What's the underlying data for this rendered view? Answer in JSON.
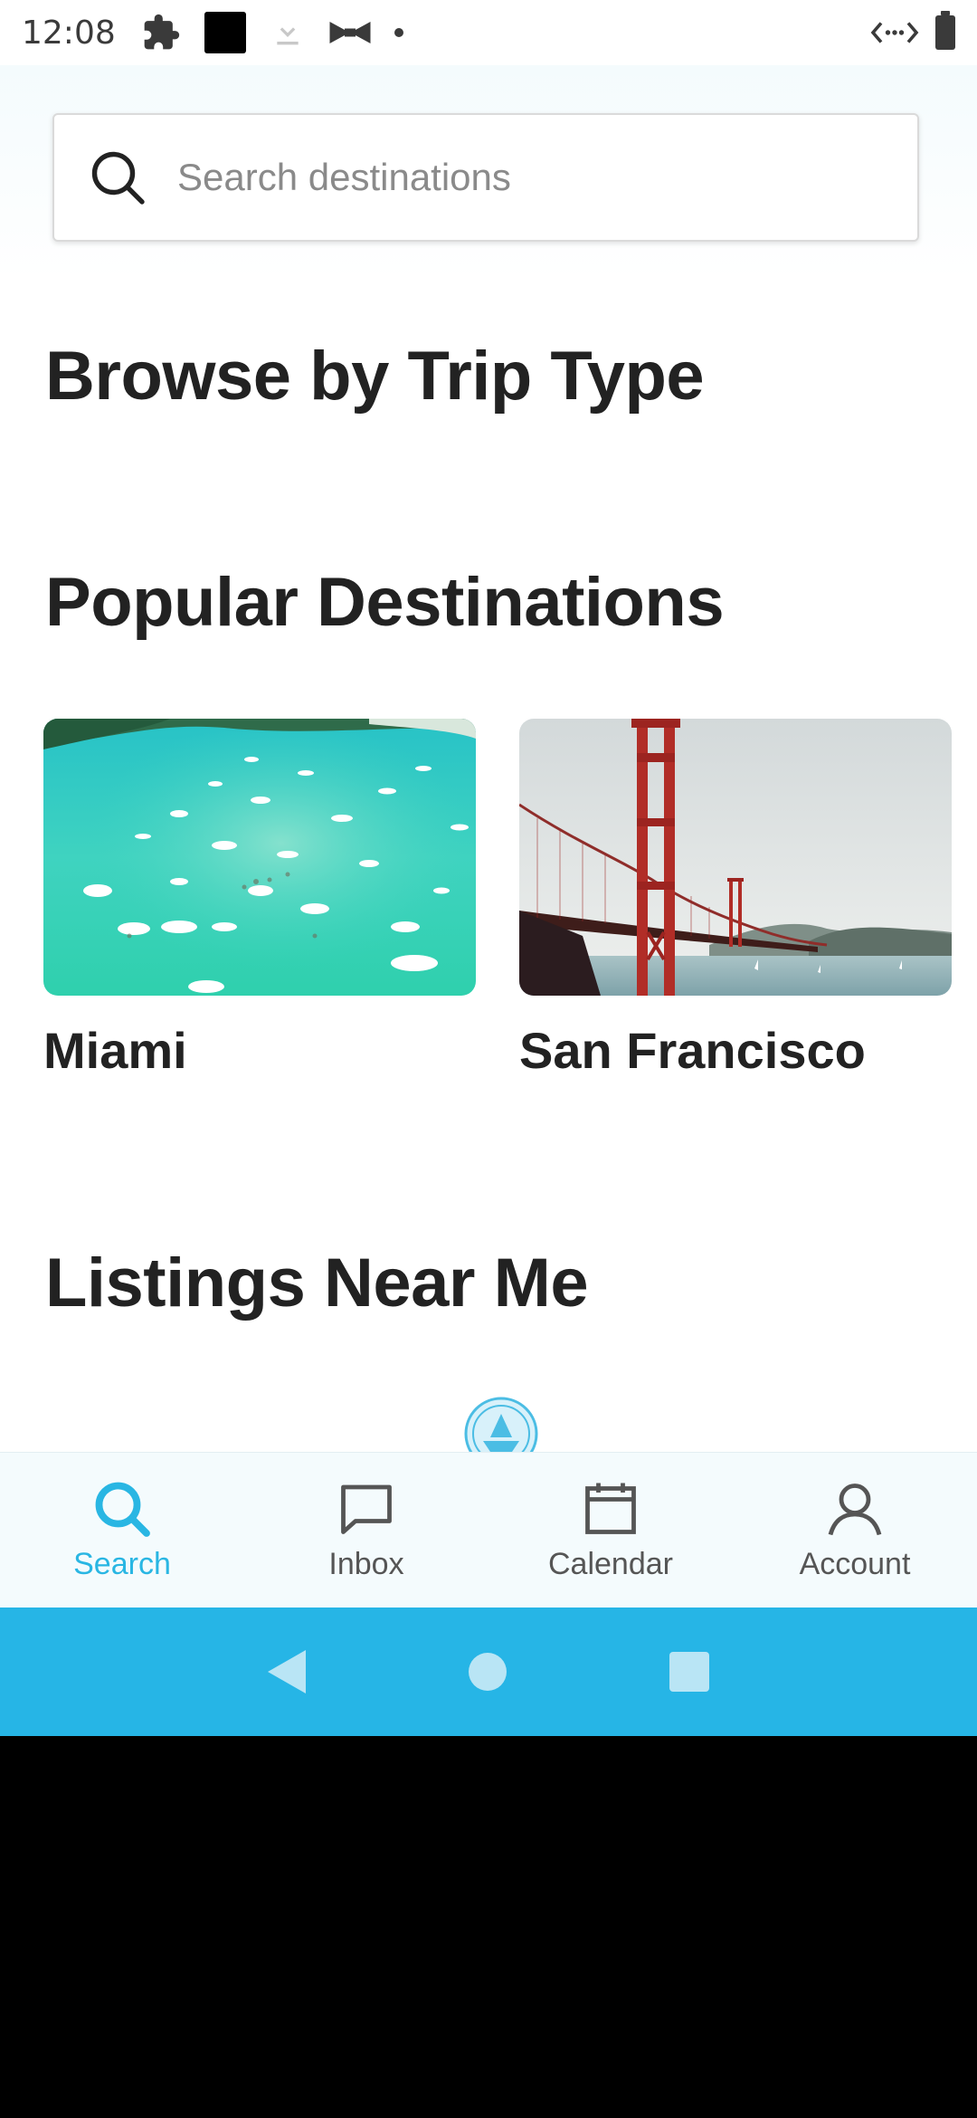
{
  "status_bar": {
    "time": "12:08",
    "left_icons": [
      "puzzle-icon",
      "black-square-icon",
      "download-icon",
      "bowtie-icon",
      "dot-icon"
    ],
    "right_icons": [
      "data-saver-icon",
      "battery-icon"
    ]
  },
  "search": {
    "placeholder": "Search destinations",
    "value": ""
  },
  "sections": {
    "trip_type_title": "Browse by Trip Type",
    "popular_title": "Popular Destinations",
    "nearby_title": "Listings Near Me"
  },
  "destinations": [
    {
      "name": "Miami"
    },
    {
      "name": "San Francisco"
    }
  ],
  "bottom_nav": {
    "items": [
      {
        "label": "Search",
        "icon": "search-icon",
        "active": true
      },
      {
        "label": "Inbox",
        "icon": "chat-icon",
        "active": false
      },
      {
        "label": "Calendar",
        "icon": "calendar-icon",
        "active": false
      },
      {
        "label": "Account",
        "icon": "account-icon",
        "active": false
      }
    ]
  },
  "colors": {
    "accent": "#29b6e3",
    "system_nav": "#26b5e6",
    "text_dark": "#222222",
    "nav_bg": "#f4fbfd"
  }
}
